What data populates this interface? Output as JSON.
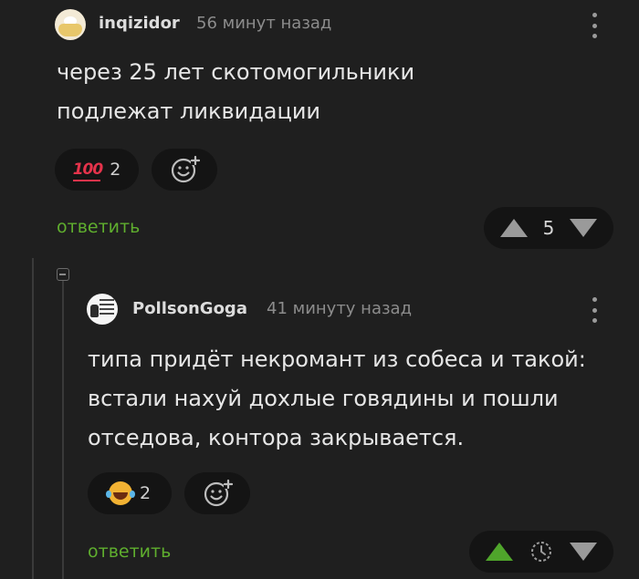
{
  "comment1": {
    "username": "inqizidor",
    "time": "56 минут назад",
    "text_lines": [
      "через 25 лет скотомогильники",
      "подлежат ликвидации"
    ],
    "reaction": {
      "emoji": "100",
      "count": "2"
    },
    "reply_label": "ответить",
    "score": "5"
  },
  "comment2": {
    "username": "PollsonGoga",
    "time": "41 минуту назад",
    "text_lines": [
      "типа придёт некромант из собеса и такой:",
      "встали нахуй дохлые говядины и пошли",
      "отседова, контора закрывается."
    ],
    "reaction": {
      "emoji": "laughing-with-tears",
      "count": "2"
    },
    "reply_label": "ответить"
  },
  "colors": {
    "background": "#1f1f1f",
    "reply_green": "#5fae2e",
    "upvote_green": "#4fa52b",
    "reaction_red": "#e5334b"
  }
}
